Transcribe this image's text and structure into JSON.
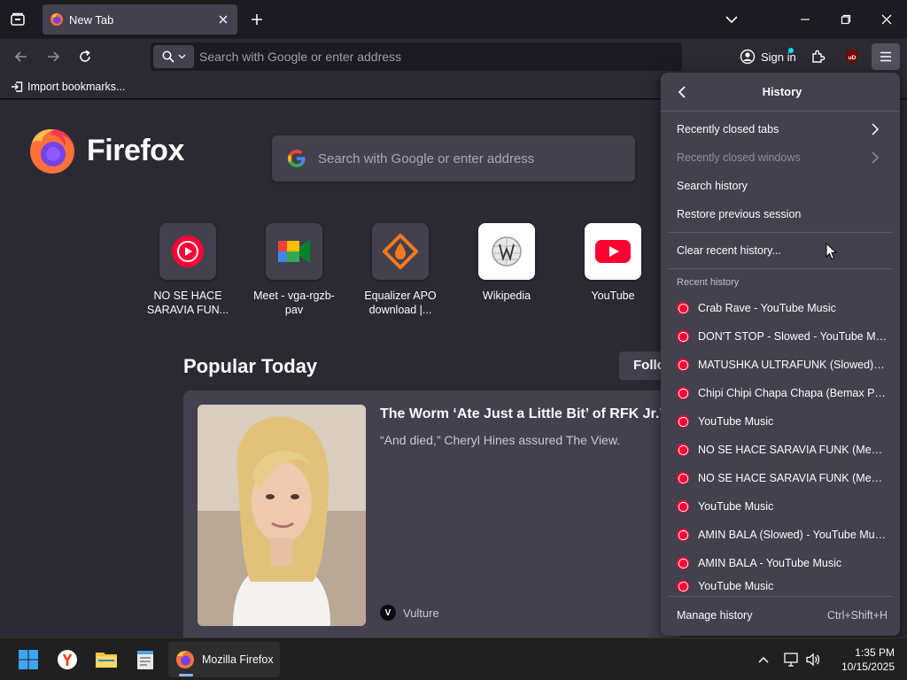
{
  "browser": {
    "tab_title": "New Tab",
    "url_placeholder": "Search with Google or enter address",
    "sign_in_label": "Sign in",
    "ublock_label": "uD",
    "bookmarks_import": "Import bookmarks..."
  },
  "newtab": {
    "brand_name": "Firefox",
    "search_placeholder": "Search with Google or enter address",
    "top_sites": [
      {
        "label": "NO SE HACE SARAVIA FUN...",
        "icon": "youtube-music-icon"
      },
      {
        "label": "Meet - vga-rgzb-pav",
        "icon": "google-meet-icon"
      },
      {
        "label": "Equalizer APO download |...",
        "icon": "equalizer-apo-icon"
      },
      {
        "label": "Wikipedia",
        "icon": "wikipedia-icon"
      },
      {
        "label": "YouTube",
        "icon": "youtube-icon"
      }
    ],
    "popular_title": "Popular Today",
    "follow_label": "Follo",
    "story": {
      "title": "The Worm ‘Ate Just a Little Bit’ of RFK Jr.’s",
      "excerpt": "“And died,” Cheryl Hines assured The View.",
      "source": "Vulture",
      "source_icon_letter": "V"
    }
  },
  "history_panel": {
    "title": "History",
    "items": [
      {
        "label": "Recently closed tabs",
        "enabled": true,
        "submenu": true
      },
      {
        "label": "Recently closed windows",
        "enabled": false,
        "submenu": true
      },
      {
        "label": "Search history",
        "enabled": true,
        "submenu": false
      },
      {
        "label": "Restore previous session",
        "enabled": true,
        "submenu": false
      }
    ],
    "clear_label": "Clear recent history...",
    "recent_label": "Recent history",
    "recent": [
      "Crab Rave - YouTube Music",
      "DON'T STOP - Slowed - YouTube Music",
      "MATUSHKA ULTRAFUNK (Slowed) - YouTube Music",
      "Chipi Chipi Chapa Chapa (Bemax Phonk Remix)",
      "YouTube Music",
      "NO SE HACE SARAVIA FUNK (Mega Slowed)",
      "NO SE HACE SARAVIA FUNK (Mega Slowed)",
      "YouTube Music",
      "AMIN BALA (Slowed) - YouTube Music",
      "AMIN BALA - YouTube Music",
      "YouTube Music"
    ],
    "manage_label": "Manage history",
    "manage_shortcut": "Ctrl+Shift+H"
  },
  "taskbar": {
    "firefox_label": "Mozilla Firefox",
    "time": "1:35 PM",
    "date": "10/15/2025"
  },
  "colors": {
    "accent": "#00ddff",
    "youtube_red": "#ff0033",
    "panel_bg": "#42414d"
  }
}
